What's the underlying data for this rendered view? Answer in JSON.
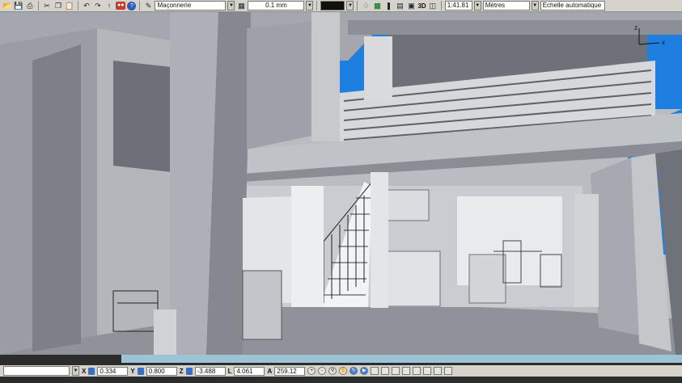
{
  "toolbar": {
    "layer_value": "Maçonnerie",
    "line_weight": "0.1 mm",
    "view3d_label": "3D",
    "scale_value": "1:41.81",
    "unit_value": "Mètres",
    "zoom_mode": "Echelle automatique"
  },
  "coords": {
    "x_label": "X",
    "x_value": "0.334",
    "y_label": "Y",
    "y_value": "0.800",
    "z_label": "Z",
    "z_value": "-3.488",
    "l_label": "L",
    "l_value": "4.061",
    "a_label": "A",
    "a_value": "259.12"
  },
  "axis_indicator": {
    "z_label": "z",
    "x_label": "x"
  },
  "colors": {
    "toolbar_bg": "#d6d3cc",
    "sky": "#1f7fe0",
    "wall_light": "#d4d6da",
    "wall_mid": "#a9acb2",
    "wall_dark": "#7d8087",
    "floor": "#8f9298"
  },
  "icons": [
    "open-icon",
    "save-icon",
    "print-icon",
    "cut-icon",
    "copy-icon",
    "paste-icon",
    "undo-icon",
    "redo-icon",
    "arrow-up-icon",
    "help-icon",
    "pencil-icon",
    "magnifier-icon",
    "orbit-icon",
    "pan-icon",
    "walk-icon",
    "camera-icon"
  ]
}
